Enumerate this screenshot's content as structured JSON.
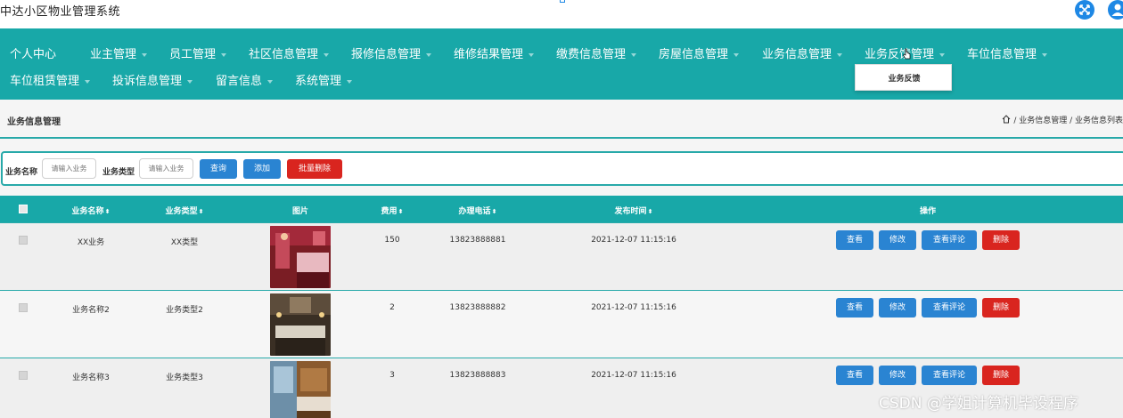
{
  "app": {
    "title": "中达小区物业管理系统"
  },
  "nav": {
    "row1": [
      {
        "label": "个人中心",
        "caret": false
      },
      {
        "label": "业主管理",
        "caret": true
      },
      {
        "label": "员工管理",
        "caret": true
      },
      {
        "label": "社区信息管理",
        "caret": true
      },
      {
        "label": "报修信息管理",
        "caret": true
      },
      {
        "label": "维修结果管理",
        "caret": true
      },
      {
        "label": "缴费信息管理",
        "caret": true
      },
      {
        "label": "房屋信息管理",
        "caret": true
      },
      {
        "label": "业务信息管理",
        "caret": true
      },
      {
        "label": "业务反馈管理",
        "caret": true
      },
      {
        "label": "车位信息管理",
        "caret": true
      }
    ],
    "row2": [
      {
        "label": "车位租赁管理",
        "caret": true
      },
      {
        "label": "投诉信息管理",
        "caret": true
      },
      {
        "label": "留言信息",
        "caret": true
      },
      {
        "label": "系统管理",
        "caret": true
      }
    ],
    "dropdown": [
      "业务反馈"
    ]
  },
  "page": {
    "title": "业务信息管理",
    "breadcrumb": "/ 业务信息管理 / 业务信息列表"
  },
  "search": {
    "name_label": "业务名称",
    "name_placeholder": "请输入业务",
    "type_label": "业务类型",
    "type_placeholder": "请输入业务",
    "query_label": "查询",
    "add_label": "添加",
    "batch_delete_label": "批量删除"
  },
  "table": {
    "columns": [
      "业务名称",
      "业务类型",
      "图片",
      "费用",
      "办理电话",
      "发布时间",
      "操作"
    ],
    "sort_glyph": "⬍",
    "rows": [
      {
        "name": "XX业务",
        "type": "XX类型",
        "fee": "150",
        "phone": "13823888881",
        "time": "2021-12-07 11:15:16",
        "image": "room-red"
      },
      {
        "name": "业务名称2",
        "type": "业务类型2",
        "fee": "2",
        "phone": "13823888882",
        "time": "2021-12-07 11:15:16",
        "image": "room-dark"
      },
      {
        "name": "业务名称3",
        "type": "业务类型3",
        "fee": "3",
        "phone": "13823888883",
        "time": "2021-12-07 11:15:16",
        "image": "room-wood"
      }
    ],
    "actions": {
      "view": "查看",
      "edit": "修改",
      "comments": "查看评论",
      "delete": "删除"
    }
  },
  "watermark": "CSDN @学姐计算机毕设程序",
  "colors": {
    "teal": "#18a8a8",
    "blue": "#2a84d2",
    "red": "#d9251f"
  }
}
